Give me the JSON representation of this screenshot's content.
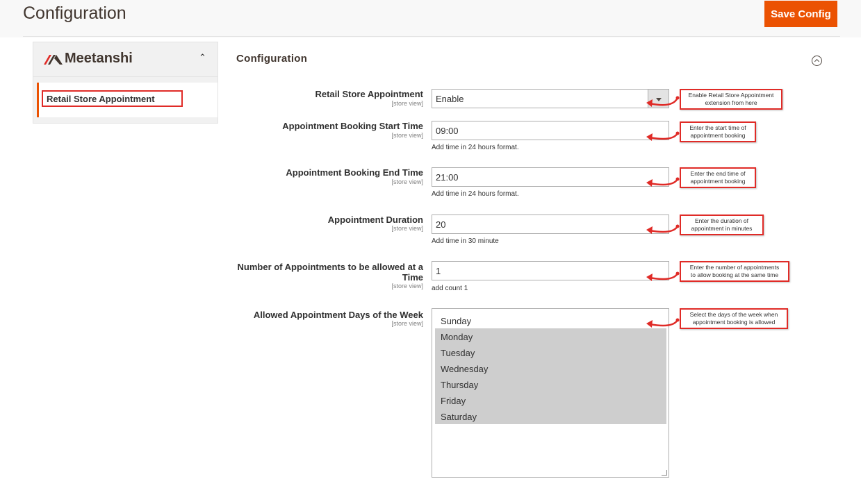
{
  "header": {
    "title": "Configuration",
    "save_label": "Save Config"
  },
  "sidebar": {
    "brand": "Meetanshi",
    "item_label": "Retail Store Appointment"
  },
  "section": {
    "title": "Configuration"
  },
  "scope_label": "[store view]",
  "fields": {
    "enable": {
      "label": "Retail Store Appointment",
      "value": "Enable"
    },
    "start_time": {
      "label": "Appointment Booking Start Time",
      "value": "09:00",
      "note": "Add time in 24 hours format."
    },
    "end_time": {
      "label": "Appointment Booking End Time",
      "value": "21:00",
      "note": "Add time in 24 hours format."
    },
    "duration": {
      "label": "Appointment Duration",
      "value": "20",
      "note": "Add time in 30 minute"
    },
    "count": {
      "label_line1": "Number of Appointments to be allowed at a",
      "label_line2": "Time",
      "value": "1",
      "note": "add count 1"
    },
    "days": {
      "label": "Allowed Appointment Days of the Week",
      "options": [
        "Sunday",
        "Monday",
        "Tuesday",
        "Wednesday",
        "Thursday",
        "Friday",
        "Saturday"
      ]
    }
  },
  "callouts": {
    "enable": [
      "Enable Retail Store Appointment",
      "extension from here"
    ],
    "start": [
      "Enter the start time of",
      "appointment booking"
    ],
    "end": [
      "Enter the end time of",
      "appointment booking"
    ],
    "duration": [
      "Enter the duration of",
      "appointment in minutes"
    ],
    "count": [
      "Enter the number of appointments",
      "to allow booking at the same time"
    ],
    "days": [
      "Select the days of the week when",
      "appointment booking is allowed"
    ]
  },
  "colors": {
    "accent": "#eb5202",
    "annotation": "#e02b27",
    "selected_option": "#cecece"
  }
}
